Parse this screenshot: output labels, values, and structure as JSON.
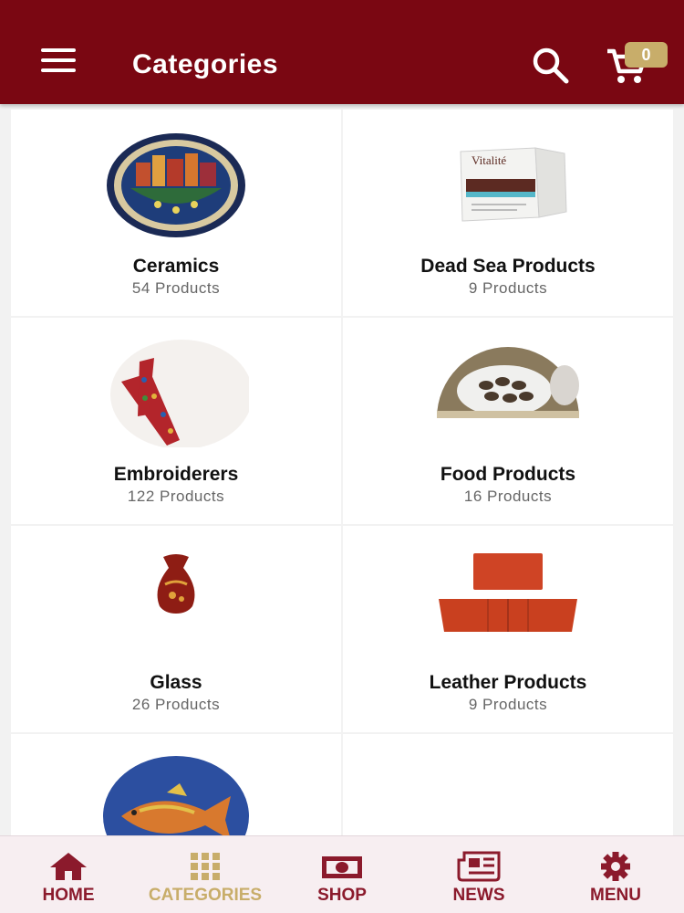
{
  "appbar": {
    "title": "Categories",
    "cart_count": "0"
  },
  "categories": [
    {
      "name": "Ceramics",
      "count": "54 Products",
      "image": "ceramic-plate-image"
    },
    {
      "name": "Dead Sea Products",
      "count": "9 Products",
      "image": "vitalite-box-image"
    },
    {
      "name": "Embroiderers",
      "count": "122 Products",
      "image": "embroidered-bookmark-image"
    },
    {
      "name": "Food Products",
      "count": "16 Products",
      "image": "date-platter-image"
    },
    {
      "name": "Glass",
      "count": "26 Products",
      "image": "glass-vase-image"
    },
    {
      "name": "Leather Products",
      "count": "9 Products",
      "image": "leather-wallet-image"
    },
    {
      "name": "",
      "count": "",
      "image": "mosaic-fish-image"
    }
  ],
  "product_image_text": {
    "vitalite_brand": "Vitalité"
  },
  "bottom_nav": [
    {
      "label": "HOME",
      "icon": "home-icon",
      "active": false
    },
    {
      "label": "CATEGORIES",
      "icon": "grid-icon",
      "active": true
    },
    {
      "label": "SHOP",
      "icon": "money-icon",
      "active": false
    },
    {
      "label": "NEWS",
      "icon": "newspaper-icon",
      "active": false
    },
    {
      "label": "MENU",
      "icon": "gear-icon",
      "active": false
    }
  ],
  "colors": {
    "primary": "#7a0712",
    "accent": "#c8ad6a",
    "nav_inactive": "#8b1a2c"
  }
}
